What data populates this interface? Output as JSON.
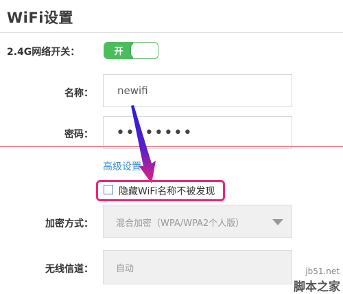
{
  "page": {
    "title": "WiFi设置"
  },
  "wifi_switch": {
    "label": "2.4G网络开关：",
    "state_label": "开",
    "state": "on"
  },
  "name_field": {
    "label": "名称：",
    "value": "newifi"
  },
  "password_field": {
    "label": "密码：",
    "value": "••••••••"
  },
  "advanced": {
    "label": "高级设置",
    "chevron": "^"
  },
  "hide_ssid": {
    "label": "隐藏WiFi名称不被发现",
    "checked": false
  },
  "encryption": {
    "label": "加密方式：",
    "value": "混合加密（WPA/WPA2个人版）"
  },
  "channel": {
    "label": "无线信道：",
    "value": "自动"
  },
  "watermark": {
    "line1": "jb51.net",
    "line2": "脚本之家"
  },
  "colors": {
    "toggle_on": "#4cbd5d",
    "link": "#3a8fd0",
    "highlight": "#e8297a",
    "arrow": "#3b1fd0"
  }
}
